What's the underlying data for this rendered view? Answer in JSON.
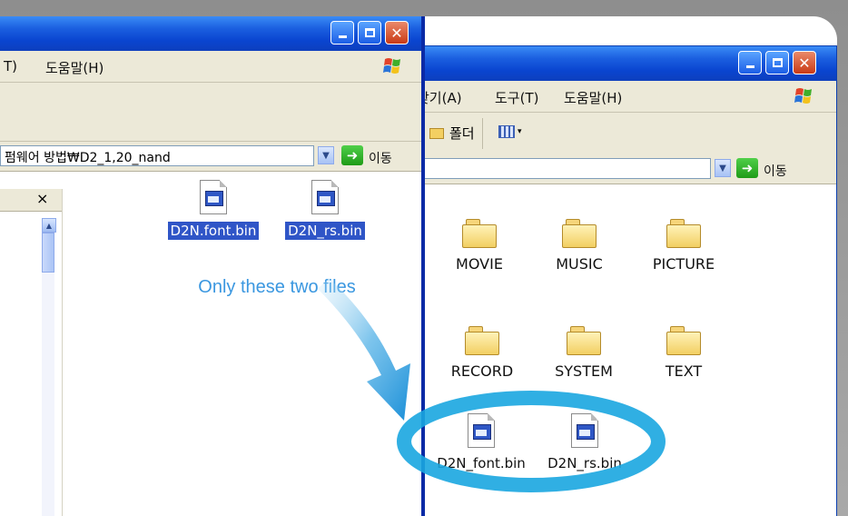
{
  "window_front": {
    "menu": {
      "partial_item": "T)",
      "help": "도움말(H)"
    },
    "address": {
      "value": "펌웨어 방법₩D2_1,20_nand",
      "go_label": "이동"
    },
    "folder_pane_close": "×",
    "files": [
      {
        "name": "D2N.font.bin"
      },
      {
        "name": "D2N_rs.bin"
      }
    ],
    "caption": "Only these two files"
  },
  "window_back": {
    "menu": {
      "favorites": "찾기(A)",
      "tools": "도구(T)",
      "help": "도움말(H)"
    },
    "toolbar": {
      "folders": "폴더"
    },
    "address": {
      "go_label": "이동"
    },
    "folders": [
      {
        "name": "MOVIE"
      },
      {
        "name": "MUSIC"
      },
      {
        "name": "PICTURE"
      },
      {
        "name": "RECORD"
      },
      {
        "name": "SYSTEM"
      },
      {
        "name": "TEXT"
      }
    ],
    "files": [
      {
        "name": "D2N_font.bin"
      },
      {
        "name": "D2N_rs.bin"
      }
    ]
  },
  "colors": {
    "title_blue": "#0a45d0",
    "selection_blue": "#2f55c7",
    "caption_blue": "#3a97e0",
    "highlight_ring": "#1aa6e0"
  },
  "icons": {
    "window_minimize": "minimize-icon",
    "window_maximize": "maximize-icon",
    "window_close": "close-icon",
    "windows_flag": "windows-flag-icon",
    "folder": "folder-icon",
    "bin_file": "bin-file-icon",
    "go_arrow": "go-arrow-icon"
  }
}
